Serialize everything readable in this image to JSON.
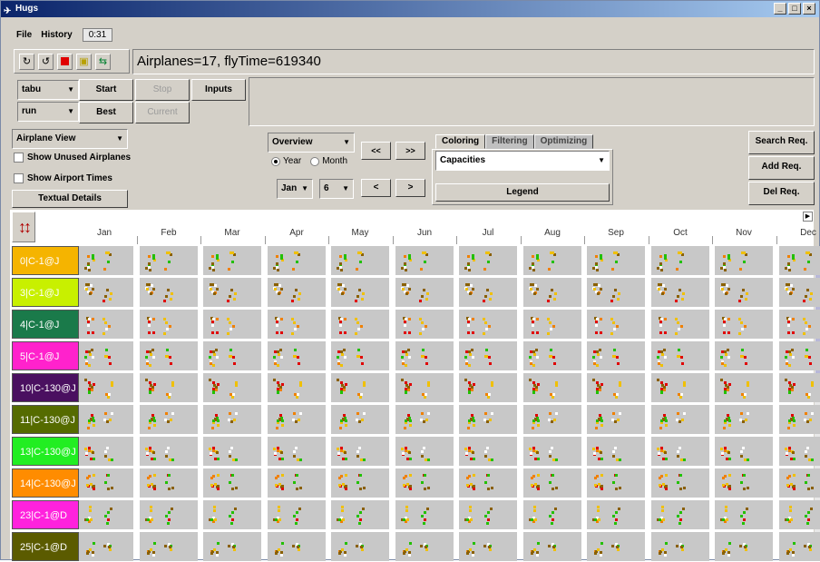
{
  "window": {
    "title": "Hugs",
    "controls": [
      "_",
      "□",
      "×"
    ]
  },
  "menu": {
    "items": [
      "File",
      "History"
    ],
    "time": "0:31"
  },
  "toolbar": {
    "icons": [
      "refresh-icon",
      "undo-icon",
      "stop-icon",
      "export-icon",
      "import-icon"
    ]
  },
  "status": "Airplanes=17, flyTime=619340",
  "controls": {
    "algo_select": "tabu",
    "mode_select": "run",
    "start_label": "Start",
    "stop_label": "Stop",
    "inputs_label": "Inputs",
    "best_label": "Best",
    "current_label": "Current"
  },
  "view": {
    "view_select": "Airplane View",
    "show_unused": "Show Unused Airplanes",
    "show_airport": "Show Airport Times",
    "textual_details": "Textual Details"
  },
  "overview": {
    "select": "Overview",
    "radio_year": "Year",
    "radio_month": "Month",
    "month_select": "Jan",
    "day_select": "6",
    "btn_prev2": "<<",
    "btn_next2": ">>",
    "btn_prev": "<",
    "btn_next": ">"
  },
  "panel": {
    "tabs": [
      "Coloring",
      "Filtering",
      "Optimizing"
    ],
    "active_tab": "Coloring",
    "coloring_select": "Capacities",
    "legend_label": "Legend"
  },
  "req": {
    "search": "Search Req.",
    "add": "Add Req.",
    "del": "Del Req."
  },
  "months": [
    "Jan",
    "Feb",
    "Mar",
    "Apr",
    "May",
    "Jun",
    "Jul",
    "Aug",
    "Sep",
    "Oct",
    "Nov",
    "Dec"
  ],
  "rows": [
    {
      "label": "0|C-1@J",
      "color": "#f5b400"
    },
    {
      "label": "3|C-1@J",
      "color": "#c8f000"
    },
    {
      "label": "4|C-1@J",
      "color": "#1a7a4a"
    },
    {
      "label": "5|C-1@J",
      "color": "#ff22cc"
    },
    {
      "label": "10|C-130@J",
      "color": "#4a1060"
    },
    {
      "label": "11|C-130@J",
      "color": "#556b00"
    },
    {
      "label": "13|C-130@J",
      "color": "#22ee22"
    },
    {
      "label": "14|C-130@J",
      "color": "#ff8c00"
    },
    {
      "label": "23|C-1@D",
      "color": "#ff22dd"
    },
    {
      "label": "25|C-1@D",
      "color": "#5b5b00"
    }
  ]
}
